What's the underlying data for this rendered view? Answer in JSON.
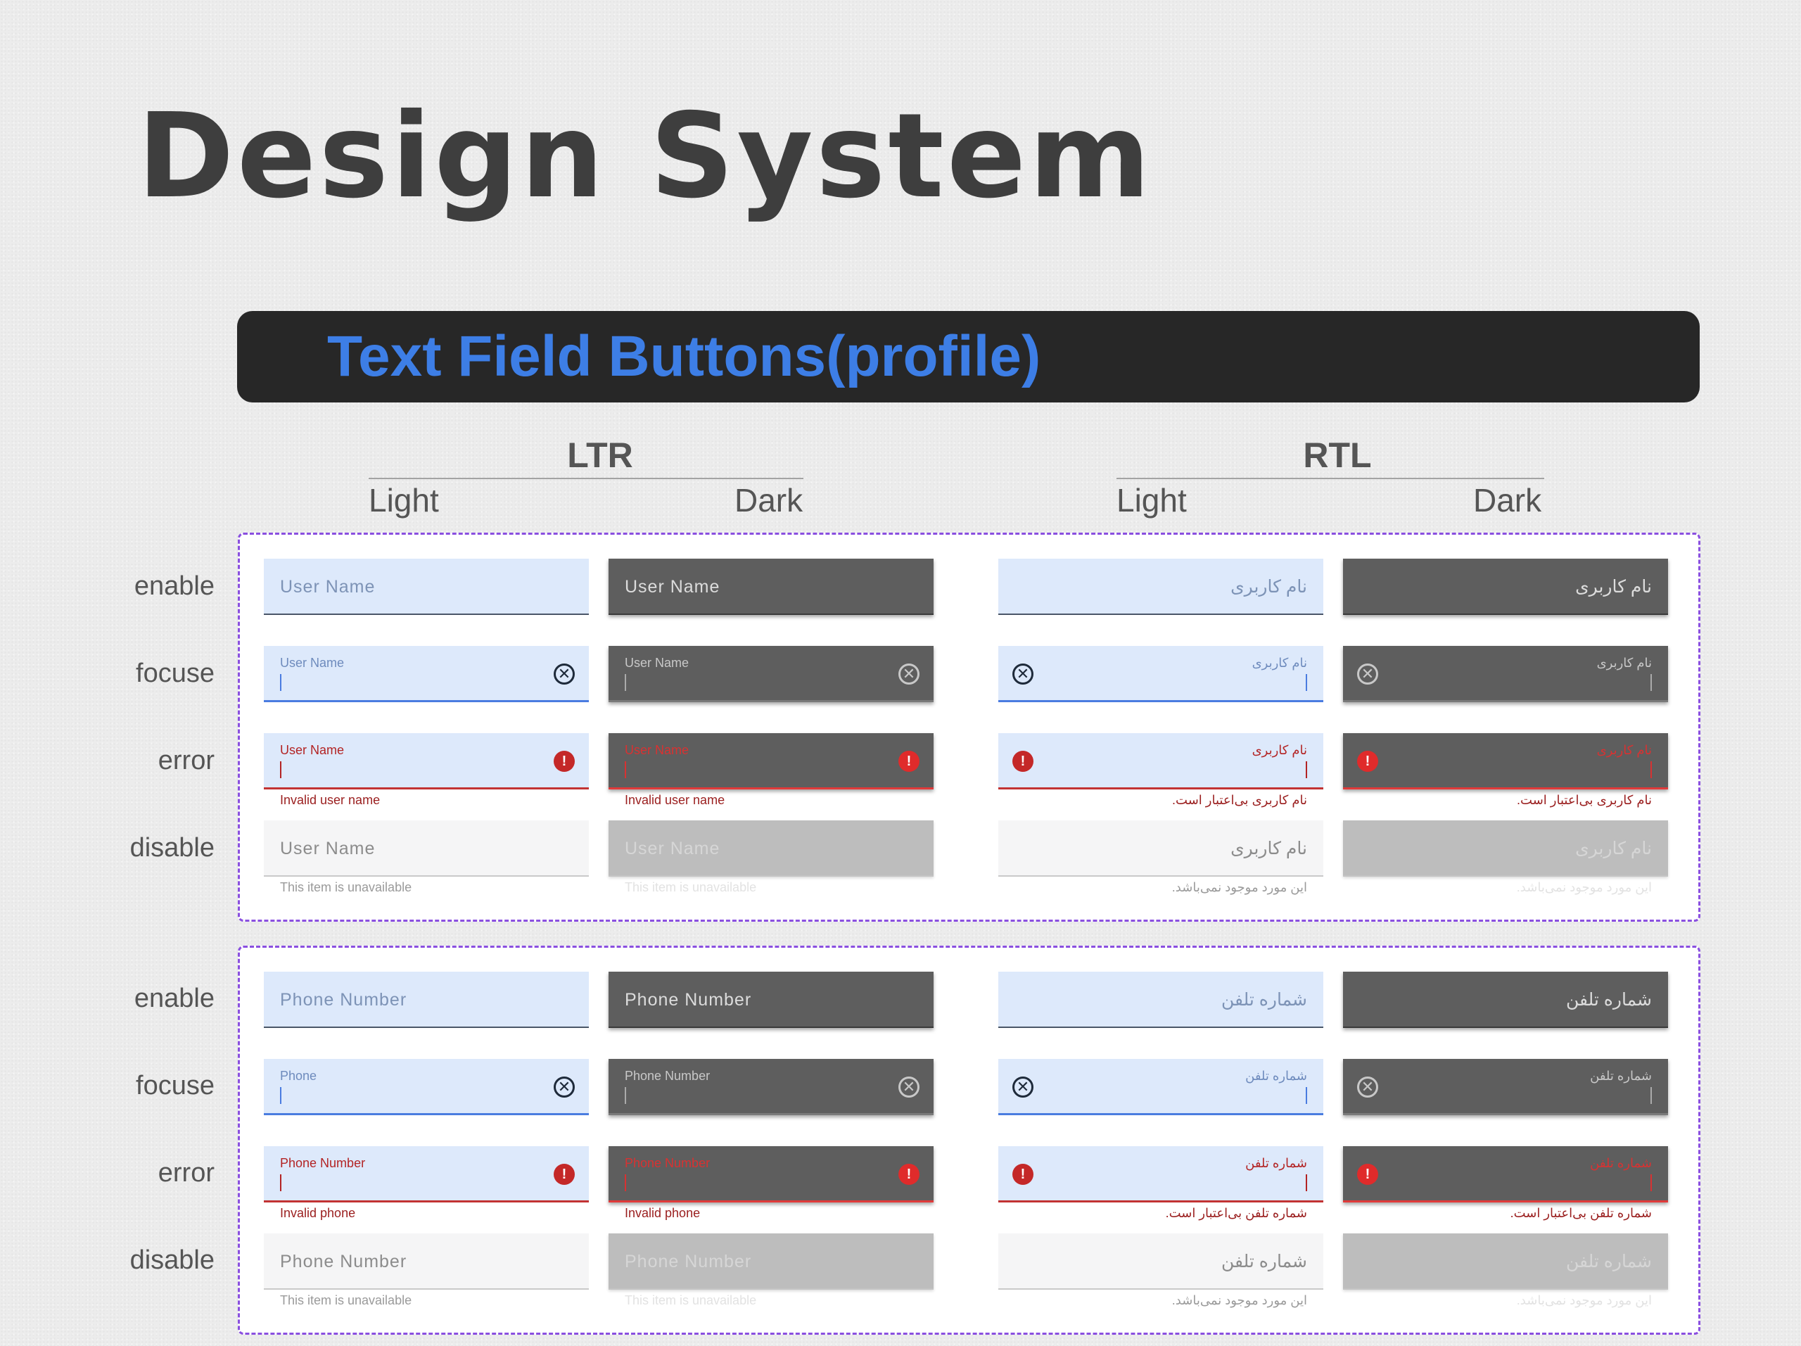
{
  "page": {
    "title": "Design System",
    "section_title": "Text Field Buttons(profile)"
  },
  "groups": {
    "ltr": "LTR",
    "rtl": "RTL",
    "light": "Light",
    "dark": "Dark"
  },
  "states": {
    "enable": "enable",
    "focus": "focuse",
    "error": "error",
    "disable": "disable"
  },
  "username": {
    "ltr_light": {
      "placeholder": "User Name",
      "focus_label": "User Name",
      "error_label": "User Name",
      "error_text": "Invalid user name",
      "disabled_text": "User Name",
      "disabled_helper": "This item is unavailable"
    },
    "ltr_dark": {
      "placeholder": "User Name",
      "focus_label": "User Name",
      "error_label": "User Name",
      "error_text": "Invalid user name",
      "disabled_text": "User Name",
      "disabled_helper": "This item is unavailable"
    },
    "rtl_light": {
      "placeholder": "نام کاربری",
      "focus_label": "نام کاربری",
      "error_label": "نام کاربری",
      "error_text": "نام کاربری بی‌اعتبار است.",
      "disabled_text": "نام کاربری",
      "disabled_helper": "این مورد موجود نمی‌باشد."
    },
    "rtl_dark": {
      "placeholder": "نام کاربری",
      "focus_label": "نام کاربری",
      "error_label": "نام کاربری",
      "error_text": "نام کاربری بی‌اعتبار است.",
      "disabled_text": "نام کاربری",
      "disabled_helper": "این مورد موجود نمی‌باشد."
    }
  },
  "phone": {
    "ltr_light": {
      "placeholder": "Phone Number",
      "focus_label": "Phone",
      "error_label": "Phone Number",
      "error_text": "Invalid phone",
      "disabled_text": "Phone Number",
      "disabled_helper": "This item is unavailable"
    },
    "ltr_dark": {
      "placeholder": "Phone Number",
      "focus_label": "Phone Number",
      "error_label": "Phone Number",
      "error_text": "Invalid phone",
      "disabled_text": "Phone Number",
      "disabled_helper": "This item is unavailable"
    },
    "rtl_light": {
      "placeholder": "شماره تلفن",
      "focus_label": "شماره تلفن",
      "error_label": "شماره تلفن",
      "error_text": "شماره تلفن بی‌اعتبار است.",
      "disabled_text": "شماره تلفن",
      "disabled_helper": "این مورد موجود نمی‌باشد."
    },
    "rtl_dark": {
      "placeholder": "شماره تلفن",
      "focus_label": "شماره تلفن",
      "error_label": "شماره تلفن",
      "error_text": "شماره تلفن بی‌اعتبار است.",
      "disabled_text": "شماره تلفن",
      "disabled_helper": "این مورد موجود نمی‌باشد."
    }
  },
  "icons": {
    "clear": "circle-x-icon",
    "clear_glyph": "✕",
    "error": "alert-circle-icon",
    "error_glyph": "!"
  },
  "colors": {
    "accent": "#3d7ee6",
    "light_field": "#dde9fb",
    "dark_field": "#5e5e5e",
    "error": "#c42828",
    "block_border": "#8a4fe0"
  }
}
